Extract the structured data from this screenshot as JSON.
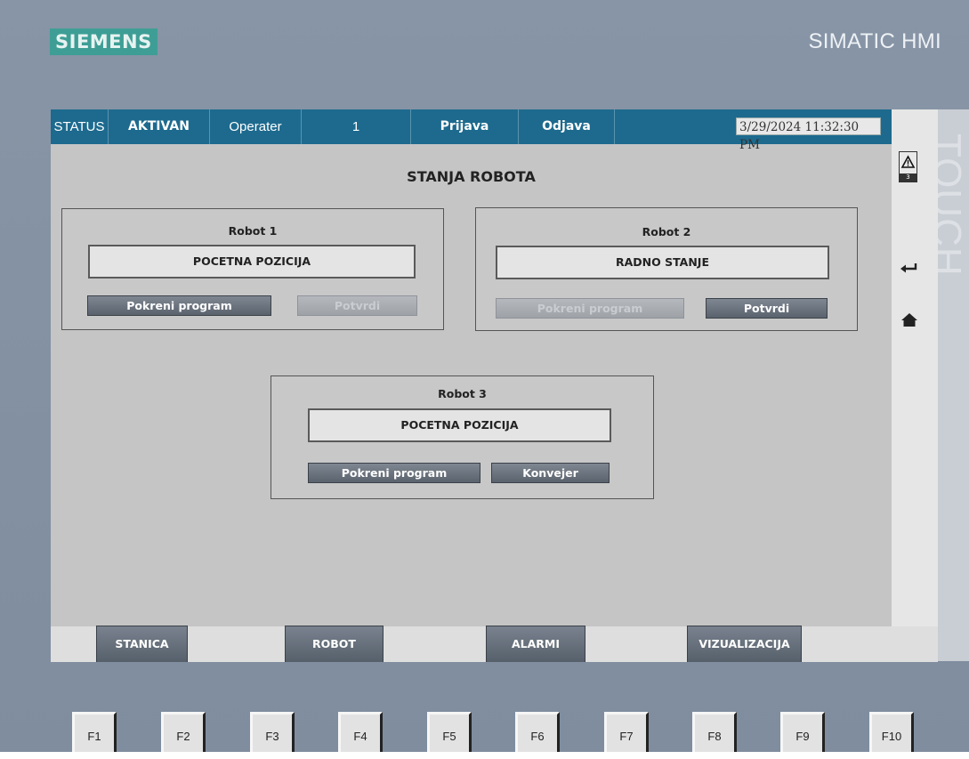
{
  "brand": {
    "logo": "SIEMENS",
    "product": "SIMATIC HMI",
    "side_text": "TOUCH"
  },
  "status_bar": {
    "status_label": "STATUS",
    "status_value": "AKTIVAN",
    "user_label": "Operater",
    "user_value": "1",
    "login_label": "Prijava",
    "logout_label": "Odjava",
    "datetime": "3/29/2024 11:32:30 PM"
  },
  "side": {
    "alarm_count": "3",
    "icons": [
      "alarm-icon",
      "return-icon",
      "home-icon"
    ]
  },
  "main": {
    "title": "STANJA ROBOTA",
    "robots": [
      {
        "name": "Robot 1",
        "state": "POCETNA POZICIJA",
        "buttons": [
          {
            "label": "Pokreni program",
            "enabled": true
          },
          {
            "label": "Potvrdi",
            "enabled": false
          }
        ]
      },
      {
        "name": "Robot 2",
        "state": "RADNO STANJE",
        "buttons": [
          {
            "label": "Pokreni program",
            "enabled": false
          },
          {
            "label": "Potvrdi",
            "enabled": true
          }
        ]
      },
      {
        "name": "Robot 3",
        "state": "POCETNA POZICIJA",
        "buttons": [
          {
            "label": "Pokreni program",
            "enabled": true
          },
          {
            "label": "Konvejer",
            "enabled": true
          }
        ]
      }
    ]
  },
  "nav": {
    "items": [
      "STANICA",
      "ROBOT",
      "ALARMI",
      "VIZUALIZACIJA"
    ]
  },
  "function_keys": [
    "F1",
    "F2",
    "F3",
    "F4",
    "F5",
    "F6",
    "F7",
    "F8",
    "F9",
    "F10"
  ],
  "colors": {
    "header": "#1d6a8e",
    "screen_bg": "#c5c5c5",
    "bezel": "#8391a3",
    "logo_bg": "#3e9e95",
    "button": "#646c77"
  }
}
